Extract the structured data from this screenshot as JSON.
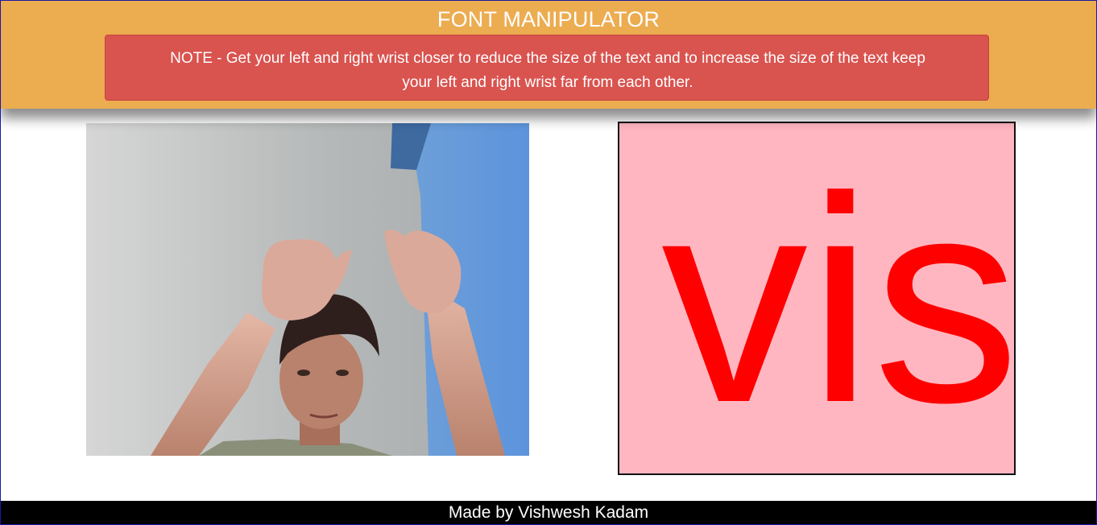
{
  "header": {
    "title": "FONT MANIPULATOR",
    "note": "NOTE - Get your left and right wrist closer to reduce the size of the text and to increase the size of the text keep your left and right wrist far from each other."
  },
  "camera": {
    "alt": "webcam video feed"
  },
  "canvas": {
    "text": "vis",
    "background": "#ffb6c1",
    "text_color": "#ff0000"
  },
  "footer": {
    "credit": "Made by Vishwesh Kadam"
  },
  "colors": {
    "header_bg": "#ecac50",
    "note_bg": "#d9534f",
    "footer_bg": "#000000"
  }
}
